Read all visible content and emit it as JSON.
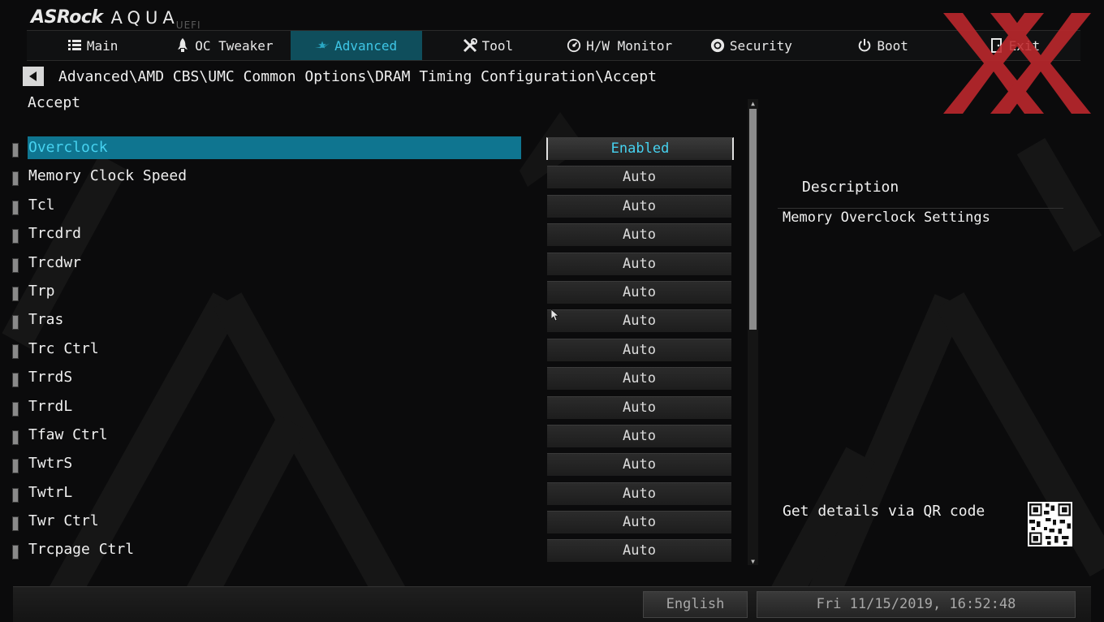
{
  "brand": {
    "name": "ASRock",
    "product": "AQUA",
    "suffix": "UEFI"
  },
  "nav": {
    "tabs": [
      {
        "label": "Main",
        "icon": "list-icon"
      },
      {
        "label": "OC Tweaker",
        "icon": "rocket-icon"
      },
      {
        "label": "Advanced",
        "icon": "star-icon",
        "active": true
      },
      {
        "label": "Tool",
        "icon": "tools-icon"
      },
      {
        "label": "H/W Monitor",
        "icon": "gauge-icon"
      },
      {
        "label": "Security",
        "icon": "shield-icon"
      },
      {
        "label": "Boot",
        "icon": "power-icon"
      },
      {
        "label": "Exit",
        "icon": "exit-icon"
      }
    ]
  },
  "breadcrumb": "Advanced\\AMD CBS\\UMC Common Options\\DRAM Timing Configuration\\Accept",
  "section_title": "Accept",
  "settings": [
    {
      "label": "Overclock",
      "value": "Enabled",
      "selected": true
    },
    {
      "label": "Memory Clock Speed",
      "value": "Auto"
    },
    {
      "label": "Tcl",
      "value": "Auto"
    },
    {
      "label": "Trcdrd",
      "value": "Auto"
    },
    {
      "label": "Trcdwr",
      "value": "Auto"
    },
    {
      "label": "Trp",
      "value": "Auto"
    },
    {
      "label": "Tras",
      "value": "Auto"
    },
    {
      "label": "Trc Ctrl",
      "value": "Auto"
    },
    {
      "label": "TrrdS",
      "value": "Auto"
    },
    {
      "label": "TrrdL",
      "value": "Auto"
    },
    {
      "label": "Tfaw Ctrl",
      "value": "Auto"
    },
    {
      "label": "TwtrS",
      "value": "Auto"
    },
    {
      "label": "TwtrL",
      "value": "Auto"
    },
    {
      "label": "Twr Ctrl",
      "value": "Auto"
    },
    {
      "label": "Trcpage Ctrl",
      "value": "Auto"
    }
  ],
  "description": {
    "title": "Description",
    "text": "Memory Overclock Settings",
    "qr_label": "Get details via QR code"
  },
  "footer": {
    "language": "English",
    "datetime": "Fri 11/15/2019, 16:52:48"
  },
  "colors": {
    "accent": "#46d2f0",
    "active_tab": "#0f4e5c",
    "selected_row": "#0f7590",
    "watermark": "#c0282d"
  }
}
